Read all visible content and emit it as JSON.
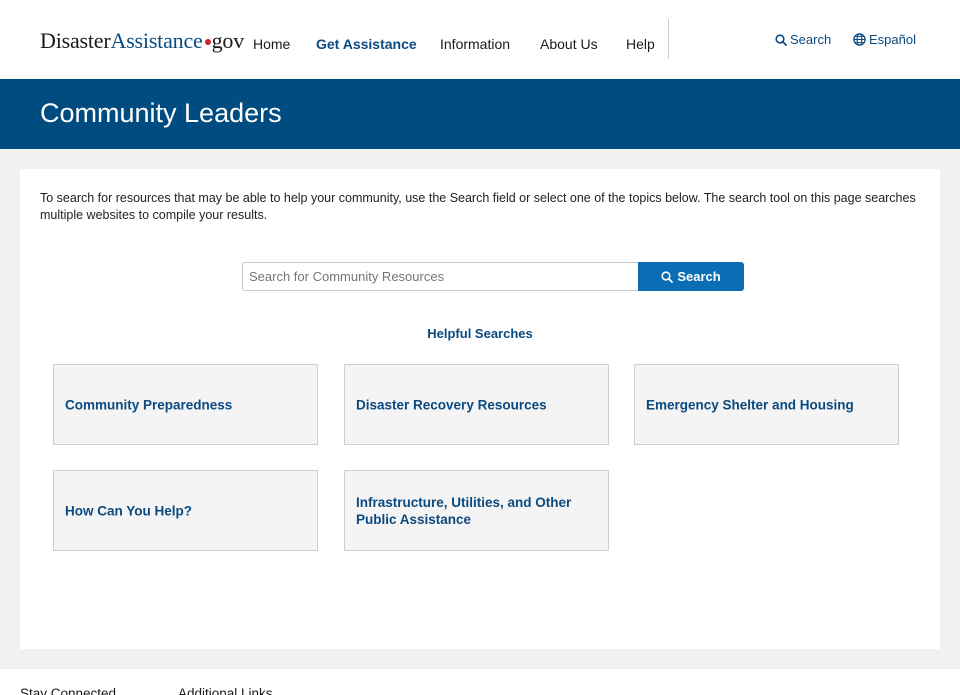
{
  "header": {
    "logo": {
      "part1": "Disaster",
      "part2": "Assistance",
      "part3": "gov"
    },
    "nav": [
      {
        "label": "Home",
        "active": false
      },
      {
        "label": "Get Assistance",
        "active": true
      },
      {
        "label": "Information",
        "active": false
      },
      {
        "label": "About Us",
        "active": false
      },
      {
        "label": "Help",
        "active": false
      }
    ],
    "search_link": "Search",
    "language_link": "Español"
  },
  "banner": {
    "title": "Community Leaders"
  },
  "main": {
    "intro": "To search for resources that may be able to help your community, use the Search field or select one of the topics below. The search tool on this page searches multiple websites to compile your results.",
    "search": {
      "placeholder": "Search for Community Resources",
      "value": "",
      "button_label": "Search"
    },
    "helpful_heading": "Helpful Searches",
    "cards": [
      {
        "label": "Community Preparedness"
      },
      {
        "label": "Disaster Recovery Resources"
      },
      {
        "label": "Emergency Shelter and Housing"
      },
      {
        "label": "How Can You Help?"
      },
      {
        "label": "Infrastructure, Utilities, and Other Public Assistance"
      }
    ]
  },
  "footer": {
    "col1": "Stay Connected",
    "col2": "Additional Links"
  },
  "colors": {
    "brand_blue": "#004b80",
    "link_blue": "#0b4a80",
    "button_blue": "#0b6eb5",
    "logo_dot": "#c1272d"
  },
  "icons": {
    "search": "search-icon",
    "language": "globe-icon"
  }
}
